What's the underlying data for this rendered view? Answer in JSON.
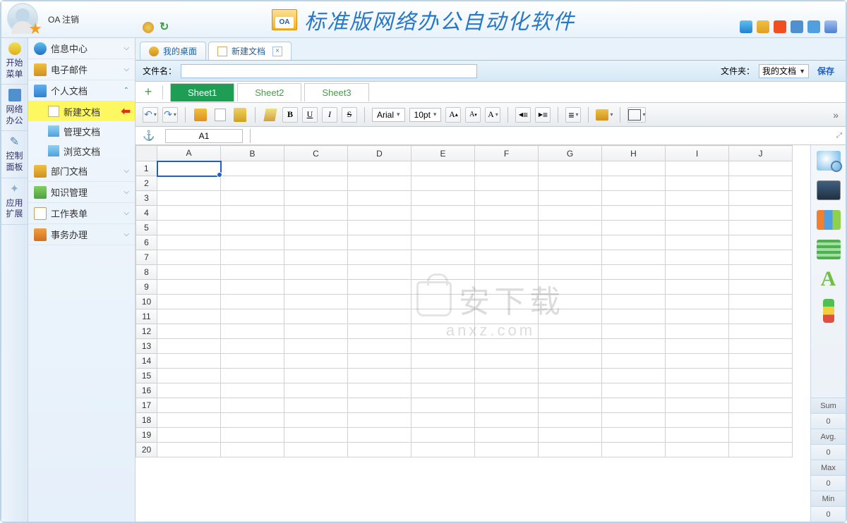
{
  "header": {
    "logout_label": "OA 注销",
    "title": "标准版网络办公自动化软件",
    "title_badge": "OA"
  },
  "left_rail": [
    {
      "label": "开始菜单"
    },
    {
      "label": "网络办公"
    },
    {
      "label": "控制面板"
    },
    {
      "label": "应用扩展"
    }
  ],
  "sidebar": {
    "groups": [
      {
        "icon": "ni1",
        "label": "信息中心",
        "chev": "❤"
      },
      {
        "icon": "ni2",
        "label": "电子邮件",
        "chev": "❤"
      },
      {
        "icon": "ni3",
        "label": "个人文档",
        "chev": "❥",
        "expanded": true,
        "children": [
          {
            "icon": "si1",
            "label": "新建文档",
            "highlighted": true,
            "arrow": true
          },
          {
            "icon": "si2",
            "label": "管理文档"
          },
          {
            "icon": "si3",
            "label": "浏览文档"
          }
        ]
      },
      {
        "icon": "ni7",
        "label": "部门文档",
        "chev": "❤"
      },
      {
        "icon": "ni4",
        "label": "知识管理",
        "chev": "❤"
      },
      {
        "icon": "ni6",
        "label": "工作表单",
        "chev": "❤"
      },
      {
        "icon": "ni5",
        "label": "事务办理",
        "chev": "❤"
      }
    ]
  },
  "tabs": [
    {
      "icon": "tc1",
      "label": "我的桌面"
    },
    {
      "icon": "tc2",
      "label": "新建文档",
      "active": true,
      "closeable": true
    }
  ],
  "filename_bar": {
    "label": "文件名：",
    "folder_label": "文件夹：",
    "folder_value": "我的文档",
    "save_label": "保存"
  },
  "sheet_tabs": [
    "Sheet1",
    "Sheet2",
    "Sheet3"
  ],
  "active_sheet": 0,
  "toolbar": {
    "font": "Arial",
    "size": "10pt"
  },
  "cell_ref": "A1",
  "columns": [
    "A",
    "B",
    "C",
    "D",
    "E",
    "F",
    "G",
    "H",
    "I",
    "J"
  ],
  "row_count": 20,
  "selected_cell": {
    "row": 1,
    "col": 0
  },
  "stats": [
    {
      "label": "Sum",
      "value": "0"
    },
    {
      "label": "Avg.",
      "value": "0"
    },
    {
      "label": "Max",
      "value": "0"
    },
    {
      "label": "Min",
      "value": "0"
    }
  ],
  "watermark": {
    "top": "安下载",
    "sub": "anxz.com"
  }
}
